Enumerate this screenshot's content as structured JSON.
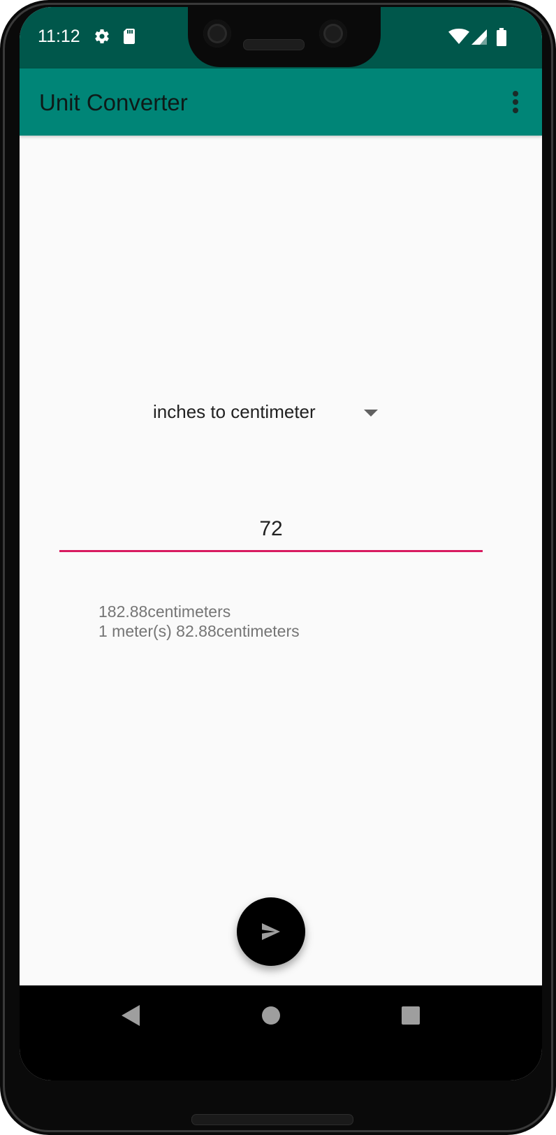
{
  "status_bar": {
    "time": "11:12",
    "left_icons": [
      "gear-icon",
      "sd-card-icon"
    ],
    "right_icons": [
      "wifi-icon",
      "signal-icon",
      "battery-icon"
    ]
  },
  "app_bar": {
    "title": "Unit Converter",
    "overflow_icon": "more-vert-icon"
  },
  "converter": {
    "selected_conversion": "inches to centimeter",
    "input_value": "72",
    "results": [
      "182.88centimeters",
      "1 meter(s) 82.88centimeters"
    ]
  },
  "fab": {
    "icon": "send-icon"
  },
  "nav_bar": {
    "icons": [
      "back-icon",
      "home-icon",
      "recents-icon"
    ]
  },
  "colors": {
    "status_bar": "#00574B",
    "app_bar": "#008577",
    "accent": "#D81B60",
    "background": "#FAFAFA",
    "fab": "#000000"
  }
}
